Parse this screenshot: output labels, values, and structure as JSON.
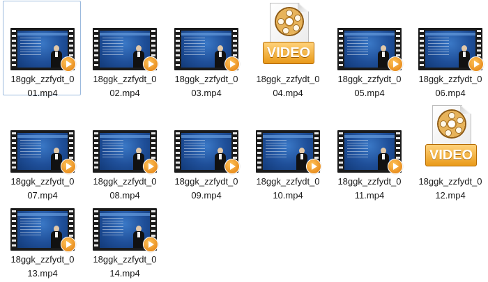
{
  "files": [
    {
      "name_line1": "18ggk_zzfydt_0",
      "name_line2": "01.mp4",
      "thumb": "video-frame",
      "selected": true
    },
    {
      "name_line1": "18ggk_zzfydt_0",
      "name_line2": "02.mp4",
      "thumb": "video-frame"
    },
    {
      "name_line1": "18ggk_zzfydt_0",
      "name_line2": "03.mp4",
      "thumb": "video-frame"
    },
    {
      "name_line1": "18ggk_zzfydt_0",
      "name_line2": "04.mp4",
      "thumb": "generic-video-icon",
      "badge": "VIDEO"
    },
    {
      "name_line1": "18ggk_zzfydt_0",
      "name_line2": "05.mp4",
      "thumb": "video-frame"
    },
    {
      "name_line1": "18ggk_zzfydt_0",
      "name_line2": "06.mp4",
      "thumb": "video-frame"
    },
    {
      "name_line1": "18ggk_zzfydt_0",
      "name_line2": "07.mp4",
      "thumb": "video-frame"
    },
    {
      "name_line1": "18ggk_zzfydt_0",
      "name_line2": "08.mp4",
      "thumb": "video-frame"
    },
    {
      "name_line1": "18ggk_zzfydt_0",
      "name_line2": "09.mp4",
      "thumb": "video-frame"
    },
    {
      "name_line1": "18ggk_zzfydt_0",
      "name_line2": "10.mp4",
      "thumb": "video-frame"
    },
    {
      "name_line1": "18ggk_zzfydt_0",
      "name_line2": "11.mp4",
      "thumb": "video-frame"
    },
    {
      "name_line1": "18ggk_zzfydt_0",
      "name_line2": "12.mp4",
      "thumb": "generic-video-icon",
      "badge": "VIDEO"
    },
    {
      "name_line1": "18ggk_zzfydt_0",
      "name_line2": "13.mp4",
      "thumb": "video-frame"
    },
    {
      "name_line1": "18ggk_zzfydt_0",
      "name_line2": "14.mp4",
      "thumb": "video-frame"
    }
  ]
}
